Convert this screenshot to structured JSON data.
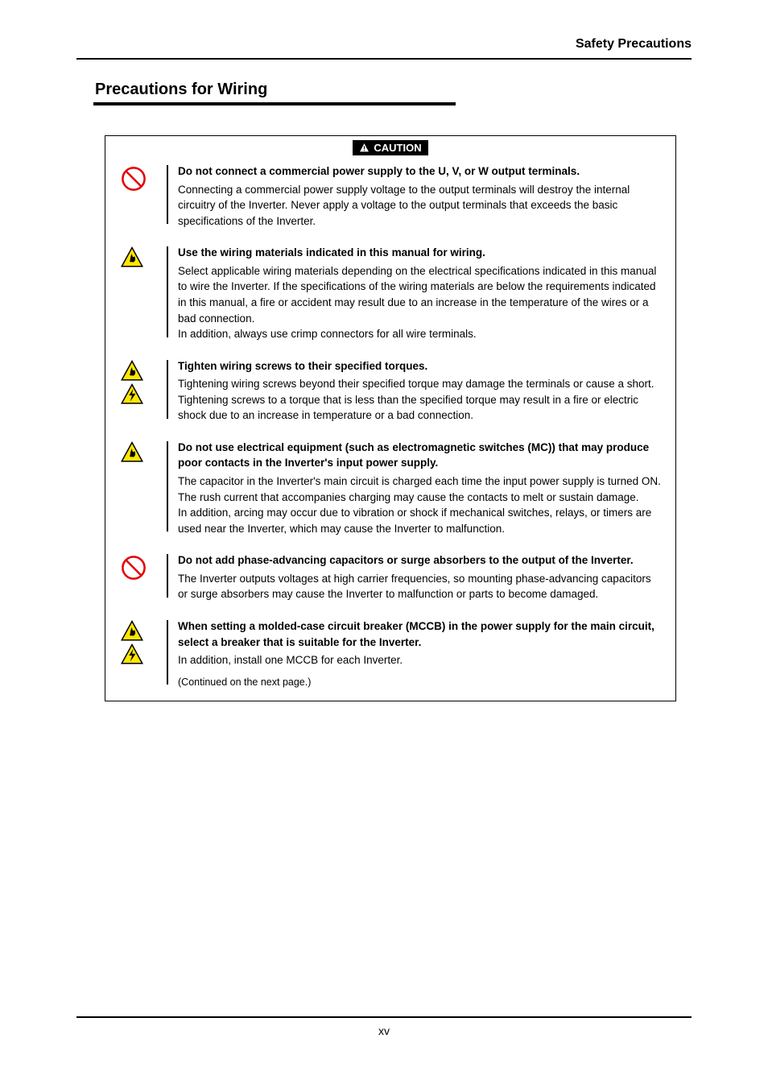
{
  "header": {
    "page_title": "Safety Precautions"
  },
  "section": {
    "title": "Precautions for Wiring"
  },
  "caution_label": "CAUTION",
  "items": [
    {
      "heading": "Do not connect a commercial power supply to the U, V, or W output terminals.",
      "body": "Connecting a commercial power supply voltage to the output terminals will destroy the internal circuitry of the Inverter. Never apply a voltage to the output terminals that exceeds the basic specifications of the Inverter."
    },
    {
      "heading": "Use the wiring materials indicated in this manual for wiring.",
      "body": "Select applicable wiring materials depending on the electrical specifications indicated in this manual to wire the Inverter. If the specifications of the wiring materials are below the requirements indicated in this manual, a fire or accident may result due to an increase in the temperature of the wires or a bad connection.\nIn addition, always use crimp connectors for all wire terminals."
    },
    {
      "heading": "Tighten wiring screws to their specified torques.",
      "body": "Tightening wiring screws beyond their specified torque may damage the terminals or cause a short. Tightening screws to a torque that is less than the specified torque may result in a fire or electric shock due to an increase in temperature or a bad connection."
    },
    {
      "heading": "Do not use electrical equipment (such as electromagnetic switches (MC)) that may produce poor contacts in the Inverter's input power supply.",
      "body": "The capacitor in the Inverter's main circuit is charged each time the input power supply is turned ON. The rush current that accompanies charging may cause the contacts to melt or sustain damage.\nIn addition, arcing may occur due to vibration or shock if mechanical switches, relays, or timers are used near the Inverter, which may cause the Inverter to malfunction."
    },
    {
      "heading": "Do not add phase-advancing capacitors or surge absorbers to the output of the Inverter.",
      "body": "The Inverter outputs voltages at high carrier frequencies, so mounting phase-advancing capacitors or surge absorbers may cause the Inverter to malfunction or parts to become damaged."
    },
    {
      "heading": "When setting a molded-case circuit breaker (MCCB) in the power supply for the main circuit, select a breaker that is suitable for the Inverter.",
      "body": "In addition, install one MCCB for each Inverter."
    }
  ],
  "continue_note": "(Continued on the next page.)",
  "page_number": "xv"
}
